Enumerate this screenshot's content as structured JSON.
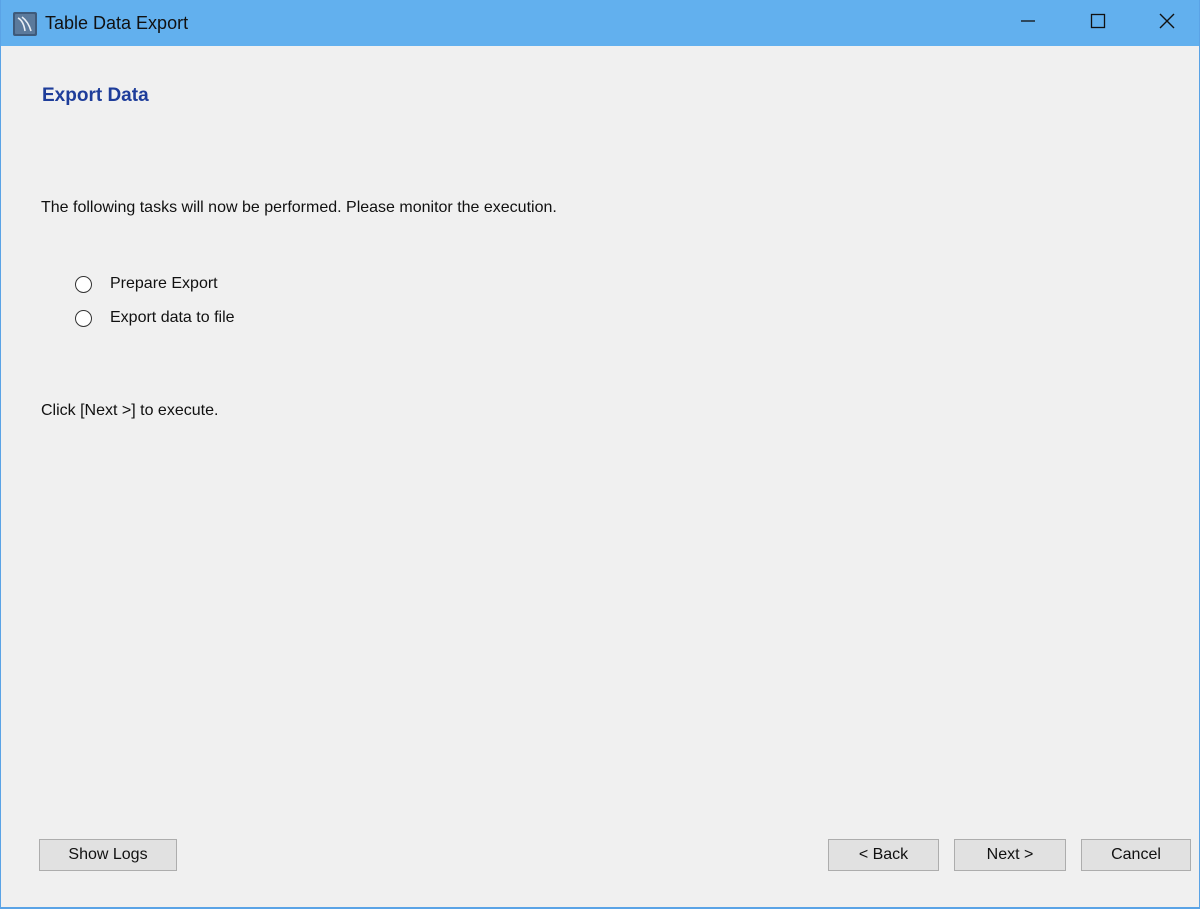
{
  "window": {
    "title": "Table Data Export",
    "icon": "mysql-workbench-icon",
    "controls": [
      "minimize-icon",
      "maximize-icon",
      "close-icon"
    ]
  },
  "content": {
    "heading": "Export Data",
    "intro": "The following tasks will now be performed. Please monitor the execution.",
    "tasks": [
      {
        "label": "Prepare Export",
        "checked": false
      },
      {
        "label": "Export data to file",
        "checked": false
      }
    ],
    "hint": "Click [Next >] to execute."
  },
  "buttons": {
    "show_logs": "Show Logs",
    "back": "< Back",
    "next": "Next >",
    "cancel": "Cancel"
  },
  "colors": {
    "titlebar": "#62b0ee",
    "heading": "#1e3d9a",
    "background": "#f0f0f0"
  }
}
